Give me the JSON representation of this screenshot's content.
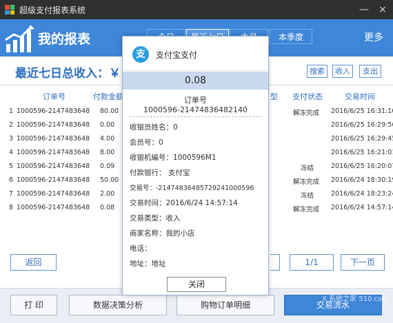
{
  "window": {
    "title": "超级支付报表系统",
    "controls": [
      "—",
      "×"
    ]
  },
  "header": {
    "title": "我的报表",
    "tabs": [
      {
        "label": "今日",
        "active": false
      },
      {
        "label": "最近七日",
        "active": true
      },
      {
        "label": "本月",
        "active": false
      },
      {
        "label": "本季度",
        "active": false
      }
    ],
    "more_label": "更多"
  },
  "summary": {
    "label": "最近七日总收入：￥1",
    "search_label": "搜索",
    "income_label": "收入",
    "expense_label": "支出"
  },
  "table": {
    "columns": [
      "订单号",
      "付款金额",
      "型",
      "支付状态",
      "交易时间"
    ],
    "rows": [
      {
        "index": "1",
        "order": "1000596-214748364856",
        "amount": "80.00",
        "status": "解冻完成",
        "time": "2016/6/25 16:31:10"
      },
      {
        "index": "2",
        "order": "1000596-214748364818",
        "amount": "0.00",
        "status": "",
        "time": "2016/6/25 16:29:56"
      },
      {
        "index": "3",
        "order": "1000596-214748364896",
        "amount": "4.00",
        "status": "",
        "time": "2016/6/25 16:29:45"
      },
      {
        "index": "4",
        "order": "1000596-214748364877",
        "amount": "8.00",
        "status": "",
        "time": "2016/6/25 16:21:01"
      },
      {
        "index": "5",
        "order": "1000596-214748364840",
        "amount": "0.09",
        "status": "冻结",
        "time": "2016/6/25 16:20:07"
      },
      {
        "index": "6",
        "order": "1000596-214748364896",
        "amount": "50.00",
        "status": "解冻完成",
        "time": "2016/6/24 18:30:19"
      },
      {
        "index": "7",
        "order": "1000596-214748364878",
        "amount": "2.00",
        "status": "冻结",
        "time": "2016/6/24 18:23:24"
      },
      {
        "index": "8",
        "order": "1000596-214748364821",
        "amount": "0.08",
        "status": "解冻完成",
        "time": "2016/6/24 14:57:14"
      }
    ]
  },
  "pager": {
    "back_label": "返回",
    "page_label": "1/1",
    "next_label": "下一页"
  },
  "bottom": {
    "print_label": "打 印",
    "analysis_label": "数据决策分析",
    "detail_label": "购物订单明细",
    "trade_label": "交易流水"
  },
  "watermark": "X 系统之家 510.com",
  "modal": {
    "title": "支付宝支付",
    "icon_glyph": "支",
    "amount": "0.08",
    "order_label": "订单号",
    "order_number": "1000596-21474836482140",
    "fields": [
      "收银员姓名：0",
      "会员号：0",
      "收银机编号：1000596M1",
      "付款银行：  支付宝",
      "交易号：-21474836485729241000596",
      "交易时间：2016/6/24 14:57:14",
      "交易类型：收入",
      "商家名称：我的小店",
      "电话：",
      "地址：地址"
    ],
    "close_label": "关闭"
  },
  "colors": {
    "brand_blue": "#3d86d8",
    "title_bar": "#2f2f2f",
    "accent_text": "#2f6fc1",
    "amount_band": "#c8d9ef"
  }
}
